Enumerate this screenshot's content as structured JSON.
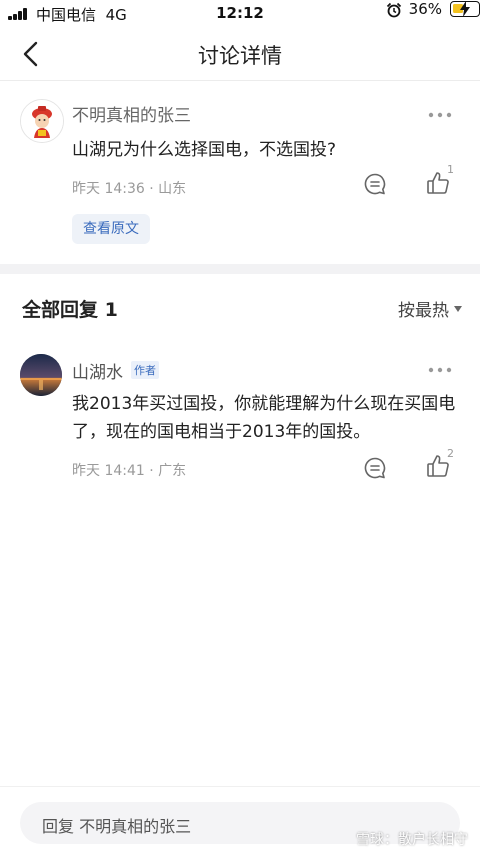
{
  "status_bar": {
    "carrier": "中国电信",
    "network": "4G",
    "time": "12:12",
    "battery_pct": "36%",
    "battery_color": "#f3c21f"
  },
  "nav": {
    "back_icon": "chevron-left-icon",
    "title": "讨论详情"
  },
  "post": {
    "username": "不明真相的张三",
    "text": "山湖兄为什么选择国电，不选国投?",
    "meta": "昨天 14:36 · 山东",
    "like_count": "1",
    "view_original_label": "查看原文"
  },
  "replies": {
    "title": "全部回复 1",
    "sort_label": "按最热"
  },
  "reply": {
    "username": "山湖水",
    "badge": "作者",
    "text": "我2013年买过国投，你就能理解为什么现在买国电了，现在的国电相当于2013年的国投。",
    "meta": "昨天 14:41 · 广东",
    "like_count": "2"
  },
  "bottom": {
    "reply_placeholder": "回复 不明真相的张三",
    "watermark": "雪球：散户长相守"
  },
  "colors": {
    "accent_blue": "#3a6bbd",
    "meta_gray": "#9a9a9a",
    "divider": "#f2f2f4"
  }
}
